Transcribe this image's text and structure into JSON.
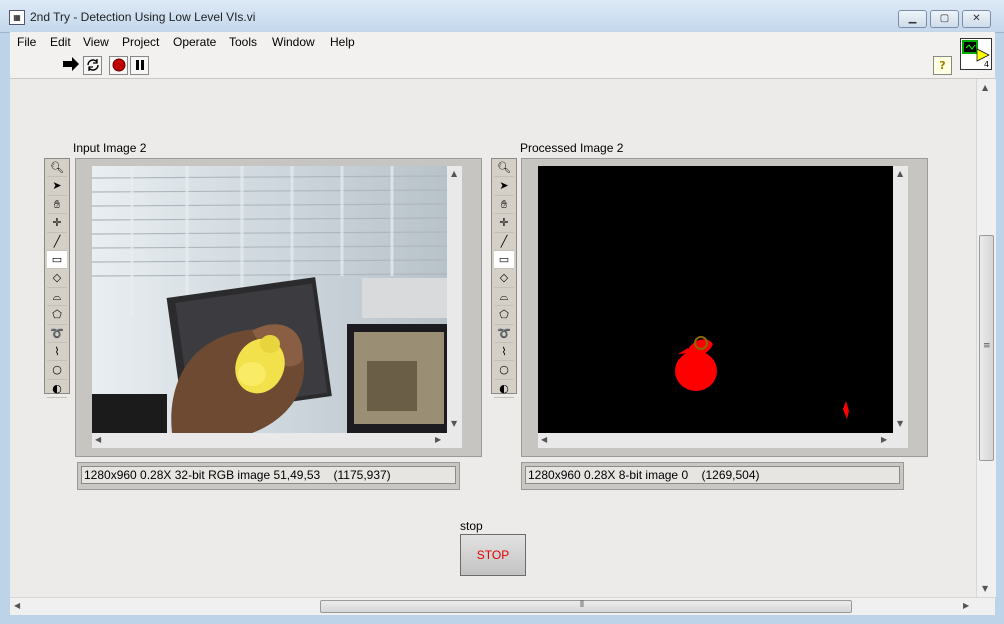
{
  "window": {
    "title": "2nd Try - Detection Using Low Level VIs.vi",
    "controls": {
      "minimize": "▁",
      "maximize": "▢",
      "close": "✕"
    }
  },
  "menu": [
    "File",
    "Edit",
    "View",
    "Project",
    "Operate",
    "Tools",
    "Window",
    "Help"
  ],
  "toolbar": {
    "icons": [
      "run-arrow",
      "run-continuous",
      "abort",
      "pause"
    ],
    "help": "?"
  },
  "vi_icon_label": "4",
  "input_image": {
    "label": "Input Image 2",
    "status": "1280x960 0.28X 32-bit RGB image 51,49,53",
    "coords": "(1175,937)"
  },
  "processed_image": {
    "label": "Processed Image 2",
    "status": "1280x960 0.28X 8-bit image 0",
    "coords": "(1269,504)"
  },
  "palette_tools": [
    "zoom",
    "arrow",
    "hand",
    "crosshair",
    "line",
    "rectangle",
    "rotated-rectangle",
    "annulus",
    "polygon",
    "freehand",
    "broken-line",
    "oval",
    "rotated-oval"
  ],
  "stop": {
    "label": "stop",
    "button": "STOP"
  },
  "colors": {
    "accent_red": "#e00000",
    "blob_red": "#ff0000"
  }
}
